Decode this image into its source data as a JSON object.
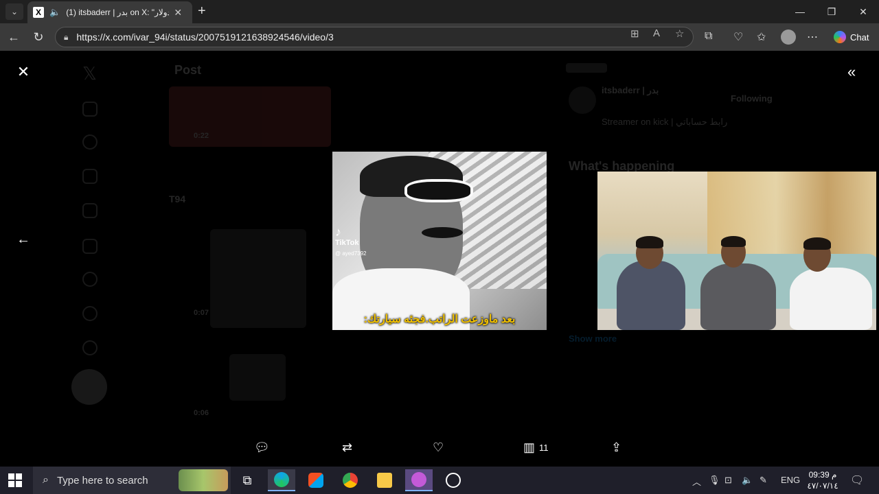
{
  "browser": {
    "tab": {
      "title": "(1) itsbaderr | بدر on X: \"دولار",
      "favicon": "X",
      "audio_icon": "speaker-icon"
    },
    "url": "https://x.com/ivar_94i/status/2007519121638924546/video/3",
    "chat_label": "Chat"
  },
  "post_background": {
    "header_title": "Post",
    "profile_name": "itsbaderr | بدر",
    "follow_button": "Following",
    "bio": "Streamer on kick | رابط حساباتي",
    "section_title": "What's happening",
    "reply_author": "T94",
    "video_time_1": "0:22",
    "video_time_2": "0:07",
    "video_time_3": "0:06",
    "show_more": "Show more"
  },
  "main_video": {
    "watermark": "TikTok",
    "handle": "@ ayed7392",
    "caption": "بعد ماوزعت الراتب.فجئه سيارتك:"
  },
  "actions": {
    "views_count": "11"
  },
  "taskbar": {
    "search_placeholder": "Type here to search",
    "language": "ENG",
    "time": "09:39 م",
    "date": "٤٧/٠٧/١٤"
  },
  "colors": {
    "caption": "#f0c000",
    "chrome_bg": "#202020",
    "taskbar_bg": "#1f1f2a"
  }
}
